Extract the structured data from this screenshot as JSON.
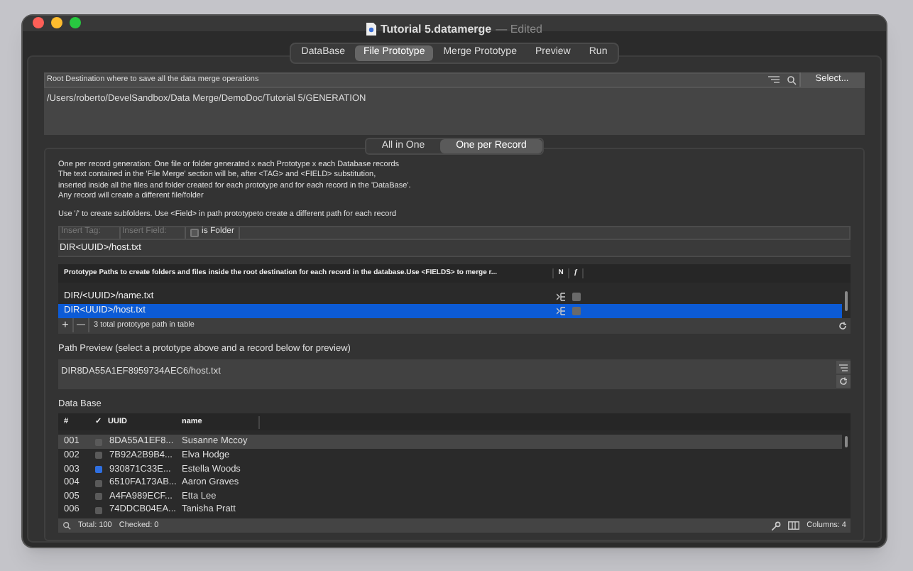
{
  "window": {
    "title": "Tutorial 5.datamerge",
    "subtitle": "— Edited"
  },
  "tabs": [
    {
      "label": "DataBase",
      "selected": false
    },
    {
      "label": "File Prototype",
      "selected": true
    },
    {
      "label": "Merge Prototype",
      "selected": false
    },
    {
      "label": "Preview",
      "selected": false
    },
    {
      "label": "Run",
      "selected": false
    }
  ],
  "root_destination": {
    "label": "Root Destination where to save all the data merge operations",
    "select_button": "Select...",
    "value": "/Users/roberto/DevelSandbox/Data Merge/DemoDoc/Tutorial 5/GENERATION"
  },
  "modes": [
    {
      "label": "All in One",
      "selected": false
    },
    {
      "label": "One per Record",
      "selected": true
    }
  ],
  "description": [
    "One per record generation: One file or folder  generated x each Prototype x each Database records",
    "The text contained in the 'File Merge' section will be, after <TAG> and <FIELD> substitution,",
    "inserted inside all the files and folder created for each prototype and for each record in the 'DataBase'.",
    "Any record will create a different file/folder"
  ],
  "hint": "Use '/' to create subfolders.  Use <Field> in path prototypeto create a different path for each record",
  "toolbar": {
    "insert_tag": "Insert Tag:",
    "insert_field": "Insert Field:",
    "is_folder": {
      "label": "is Folder",
      "checked": false
    }
  },
  "path_field": "DIR<UUID>/host.txt",
  "prototypes": {
    "columns": [
      "Prototype Paths to create folders and  files inside the root destination for each record in the database.Use <FIELDS> to merge r...",
      "N",
      "ƒ"
    ],
    "rows": [
      {
        "path": "DIR/<UUID>/name.txt",
        "selected": false,
        "folder": false
      },
      {
        "path": "DIR<UUID>/host.txt",
        "selected": true,
        "folder": false
      }
    ],
    "footer": "3 total prototype path in table",
    "add": "+",
    "remove": "—"
  },
  "path_preview": {
    "label": "Path Preview (select a prototype above and a record below for preview)",
    "value": "DIR8DA55A1EF8959734AEC6/host.txt"
  },
  "database": {
    "label": "Data Base",
    "columns": [
      "#",
      "✓",
      "UUID",
      "name"
    ],
    "rows": [
      {
        "n": "001",
        "checked": false,
        "uuid": "8DA55A1EF8...",
        "name": "Susanne Mccoy",
        "selected": true
      },
      {
        "n": "002",
        "checked": false,
        "uuid": "7B92A2B9B4...",
        "name": "Elva Hodge",
        "selected": false
      },
      {
        "n": "003",
        "checked": true,
        "uuid": "930871C33E...",
        "name": "Estella Woods",
        "selected": false
      },
      {
        "n": "004",
        "checked": false,
        "uuid": "6510FA173AB...",
        "name": "Aaron Graves",
        "selected": false
      },
      {
        "n": "005",
        "checked": false,
        "uuid": "A4FA989ECF...",
        "name": "Etta Lee",
        "selected": false
      },
      {
        "n": "006",
        "checked": false,
        "uuid": "74DDCB04EA...",
        "name": "Tanisha Pratt",
        "selected": false
      }
    ],
    "total": "Total: 100",
    "checked": "Checked: 0",
    "columns_count": "Columns: 4"
  }
}
